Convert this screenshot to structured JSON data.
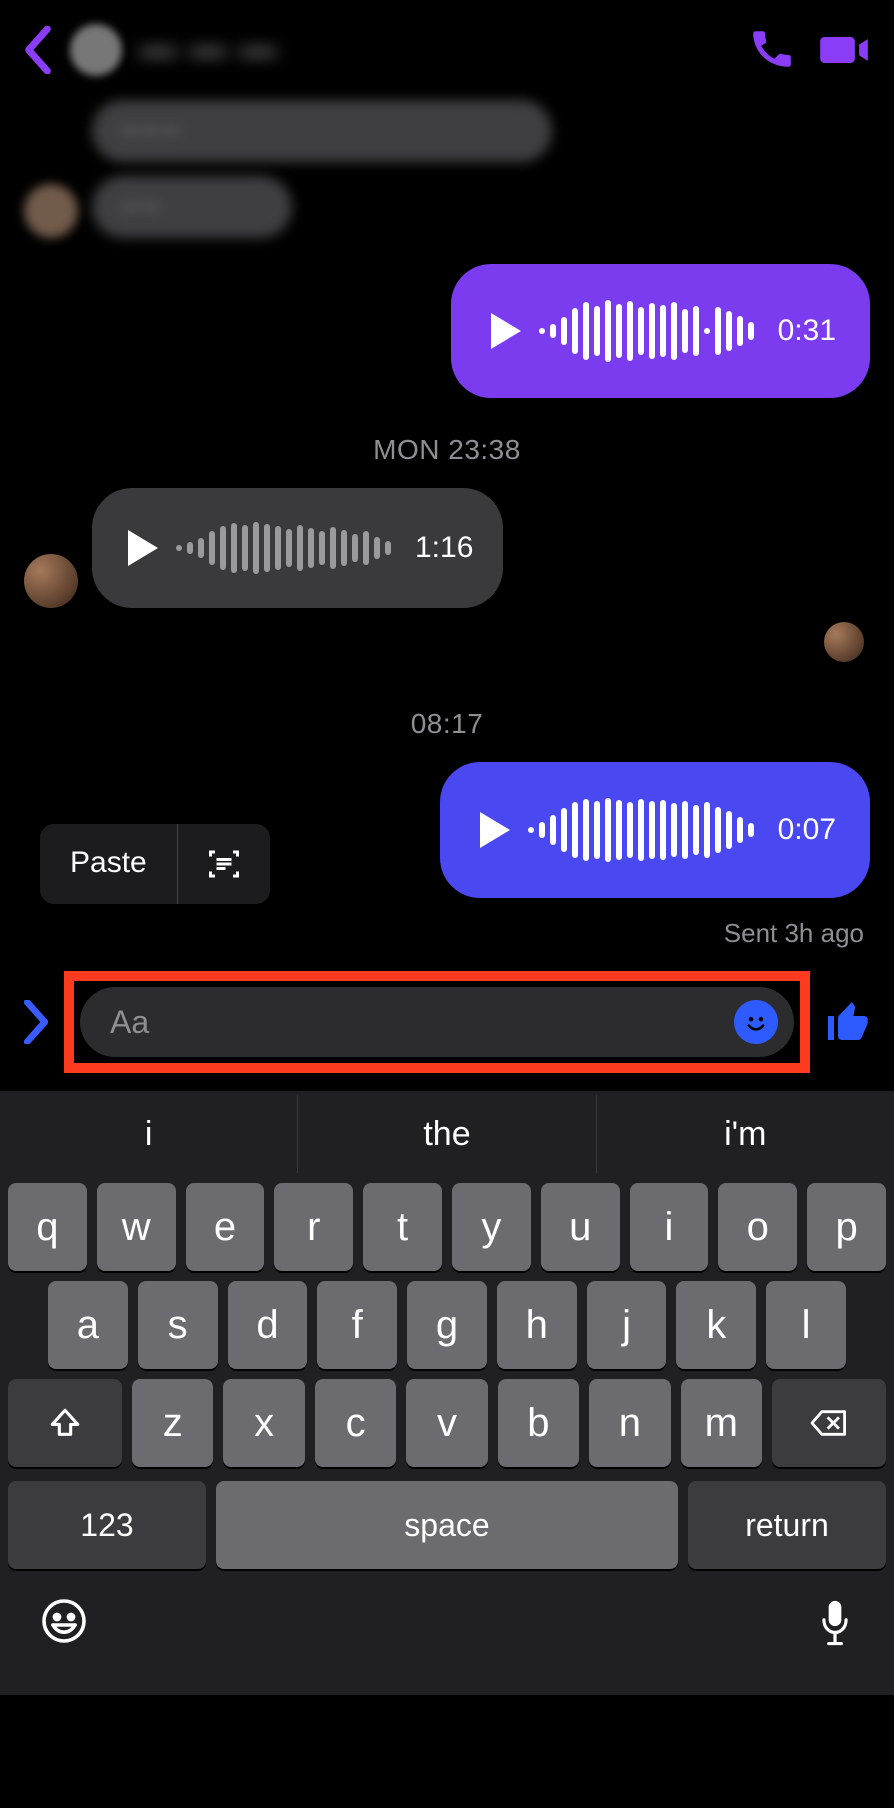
{
  "header": {
    "contact_name": "— — —"
  },
  "messages": {
    "text1": "— — —",
    "text2": "— —",
    "voice1_duration": "0:31",
    "ts1": "MON 23:38",
    "voice2_duration": "1:16",
    "ts2": "08:17",
    "voice3_duration": "0:07",
    "status": "Sent 3h ago"
  },
  "paste_popup": {
    "paste_label": "Paste"
  },
  "composer": {
    "placeholder": "Aa"
  },
  "keyboard": {
    "suggestions": [
      "i",
      "the",
      "i'm"
    ],
    "row1": [
      "q",
      "w",
      "e",
      "r",
      "t",
      "y",
      "u",
      "i",
      "o",
      "p"
    ],
    "row2": [
      "a",
      "s",
      "d",
      "f",
      "g",
      "h",
      "j",
      "k",
      "l"
    ],
    "row3": [
      "z",
      "x",
      "c",
      "v",
      "b",
      "n",
      "m"
    ],
    "numbers_label": "123",
    "space_label": "space",
    "return_label": "return"
  }
}
